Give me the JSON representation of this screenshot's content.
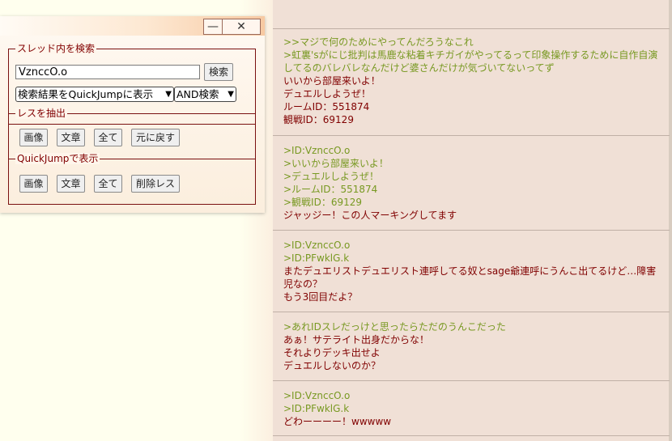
{
  "search_window": {
    "minimize_glyph": "—",
    "close_glyph": "✕",
    "search_section_legend": "スレッド内を検索",
    "search_input_value": "VznccO.o",
    "search_button": "検索",
    "result_mode_select": "検索結果をQuickJumpに表示",
    "match_mode_select": "AND検索",
    "extract_section_legend": "レスを抽出",
    "extract_buttons": [
      "画像",
      "文章",
      "全て",
      "元に戻す"
    ],
    "quickjump_section_legend": "QuickJumpで表示",
    "quickjump_buttons": [
      "画像",
      "文章",
      "全て",
      "削除レス"
    ]
  },
  "posts": [
    {
      "lines": [
        {
          "text": ">>マジで何のためにやってんだろうなこれ",
          "quote": true
        },
        {
          "text": ">虹裏'sがにじ批判は馬鹿な粘着キチガイがやってるって印象操作するために自作自演",
          "quote": true
        },
        {
          "text": "してるのバレバレなんだけど婆さんだけが気づいてないってず",
          "quote": true
        },
        {
          "text": "いいから部屋来いよ！",
          "quote": false
        },
        {
          "text": "デュエルしようぜ！",
          "quote": false
        },
        {
          "text": "ルームID：551874",
          "quote": false
        },
        {
          "text": "観戦ID：69129",
          "quote": false
        }
      ]
    },
    {
      "lines": [
        {
          "text": ">ID:VznccO.o",
          "quote": true
        },
        {
          "text": ">いいから部屋来いよ！",
          "quote": true
        },
        {
          "text": ">デュエルしようぜ！",
          "quote": true
        },
        {
          "text": ">ルームID：551874",
          "quote": true
        },
        {
          "text": ">観戦ID：69129",
          "quote": true
        },
        {
          "text": "ジャッジー！この人マーキングしてます",
          "quote": false
        }
      ]
    },
    {
      "lines": [
        {
          "text": ">ID:VznccO.o",
          "quote": true
        },
        {
          "text": ">ID:PFwklG.k",
          "quote": true
        },
        {
          "text": "またデュエリストデュエリスト連呼してる奴とsage爺連呼にうんこ出てるけど…障害",
          "quote": false
        },
        {
          "text": "児なの？",
          "quote": false
        },
        {
          "text": "もう3回目だよ？",
          "quote": false
        }
      ]
    },
    {
      "lines": [
        {
          "text": ">あれIDスレだっけと思ったらただのうんこだった",
          "quote": true
        },
        {
          "text": "あぁ！サテライト出身だからな！",
          "quote": false
        },
        {
          "text": "それよりデッキ出せよ",
          "quote": false
        },
        {
          "text": "デュエルしないのか？",
          "quote": false
        }
      ]
    },
    {
      "lines": [
        {
          "text": ">ID:VznccO.o",
          "quote": true
        },
        {
          "text": ">ID:PFwklG.k",
          "quote": true
        },
        {
          "text": "どわーーーー！wwwww",
          "quote": false
        }
      ]
    }
  ]
}
